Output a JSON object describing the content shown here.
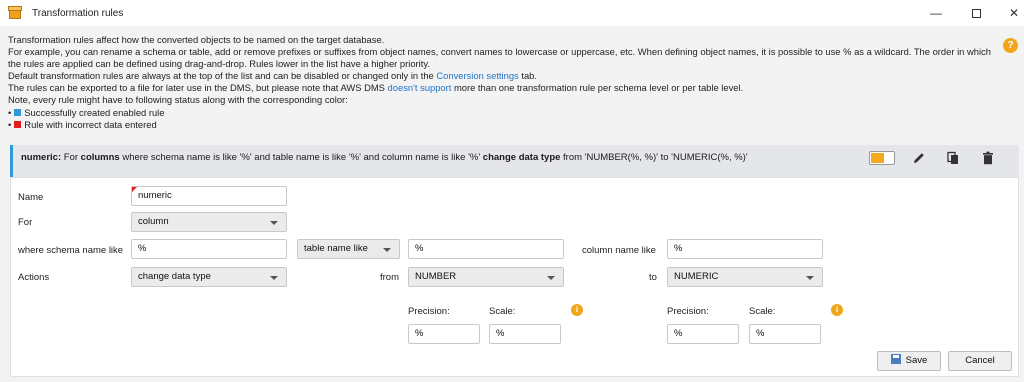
{
  "window": {
    "title": "Transformation rules",
    "controls": {
      "minimize": "—",
      "maximize": "",
      "close": "✕"
    }
  },
  "intro": {
    "line1": "Transformation rules affect how the converted objects to be named on the target database.",
    "line2": "For example, you can rename a schema or table, add or remove prefixes or suffixes from object names, convert names to lowercase or uppercase, etc. When defining object names, it is possible to use % as a wildcard. The order in which",
    "line3": "the rules are applied can be defined using drag-and-drop. Rules lower in the list have a higher priority.",
    "line4_prefix": "Default transformation rules are always at the top of the list and can be disabled or changed only in the",
    "line4_link": "Conversion settings",
    "line4_suffix": "tab.",
    "line5_prefix": "The rules can be exported to a file for later use in the DMS, but please note that AWS DMS",
    "line5_link": "doesn't support",
    "line5_suffix": "more than one transformation rule per schema level or per table level.",
    "line6": "Note, every rule might have to following status along with the corresponding color:",
    "bullet": "•",
    "legend_success": "Successfully created enabled rule",
    "legend_error": "Rule with incorrect data entered",
    "colors": {
      "success": "#2e9bd6",
      "error": "#e02020",
      "link": "#1e72c8"
    }
  },
  "help_icon": "?",
  "rule": {
    "name_bold": "numeric:",
    "t1": "For",
    "object": "columns",
    "t2": "where schema name is like '%' and table name is like '%' and column name is like '%'",
    "action": "change data type",
    "t3": "from 'NUMBER(%, %)'  to 'NUMERIC(%, %)'",
    "enabled": true
  },
  "form": {
    "name_label": "Name",
    "name_value": "numeric",
    "for_label": "For",
    "for_value": "column",
    "schema_label": "where schema name like",
    "schema_value": "%",
    "table_select": "table name like",
    "table_value": "%",
    "column_label": "column name like",
    "column_value": "%",
    "actions_label": "Actions",
    "actions_value": "change data type",
    "from_label": "from",
    "from_value": "NUMBER",
    "to_label": "to",
    "to_value": "NUMERIC",
    "from_precision_label": "Precision:",
    "from_scale_label": "Scale:",
    "from_precision_value": "%",
    "from_scale_value": "%",
    "to_precision_label": "Precision:",
    "to_scale_label": "Scale:",
    "to_precision_value": "%",
    "to_scale_value": "%",
    "info_icon": "i",
    "save_label": "Save",
    "cancel_label": "Cancel"
  }
}
